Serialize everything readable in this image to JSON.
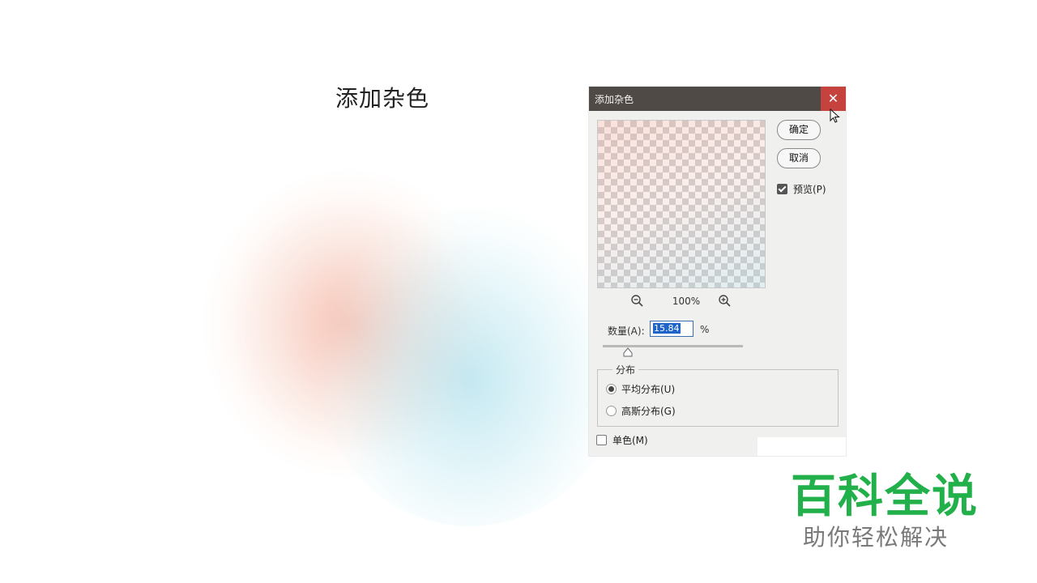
{
  "slide": {
    "title": "添加杂色"
  },
  "dialog": {
    "title": "添加杂色",
    "close_symbol": "✕",
    "ok_label": "确定",
    "cancel_label": "取消",
    "preview_label": "预览(P)",
    "preview_checked": true,
    "zoom_level": "100%",
    "amount_label": "数量(A):",
    "amount_value": "15.84",
    "amount_unit": "%",
    "distribution_legend": "分布",
    "uniform_label": "平均分布(U)",
    "gaussian_label": "高斯分布(G)",
    "selected_distribution": "uniform",
    "monochrome_label": "单色(M)",
    "monochrome_checked": false
  },
  "brand": {
    "main": "百科全说",
    "sub": "助你轻松解决"
  },
  "icons": {
    "close": "close-icon",
    "zoom_out": "zoom-out-icon",
    "zoom_in": "zoom-in-icon",
    "cursor": "mouse-cursor-icon",
    "slider": "slider-thumb-icon"
  },
  "colors": {
    "titlebar": "#4f4a46",
    "close": "#c6423e",
    "brand_green": "#22b04a",
    "selection": "#1d63c9"
  }
}
